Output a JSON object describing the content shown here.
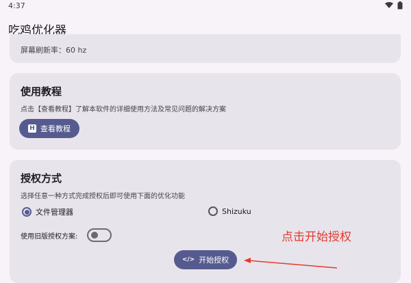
{
  "status_bar": {
    "time": "4:37",
    "icons": [
      "wifi-icon",
      "battery-icon"
    ]
  },
  "app": {
    "title": "吃鸡优化器"
  },
  "display_card": {
    "refresh_text": "屏幕刷新率：60 hz"
  },
  "tutorial_card": {
    "title": "使用教程",
    "description": "点击【查看教程】了解本软件的详细使用方法及常见问题的解决方案",
    "button_label": "查看教程",
    "button_icon_glyph": "H"
  },
  "auth_card": {
    "title": "授权方式",
    "description": "选择任意一种方式完成授权后即可使用下面的优化功能",
    "options": [
      {
        "label": "文件管理器",
        "selected": true
      },
      {
        "label": "Shizuku",
        "selected": false
      }
    ],
    "legacy_label": "使用旧版授权方案:",
    "legacy_enabled": false,
    "start_button_label": "开始授权",
    "start_button_icon_glyph": "</>"
  },
  "annotation": {
    "text": "点击开始授权",
    "color": "#e23b2e"
  },
  "colors": {
    "accent": "#565b8f",
    "card_bg": "#e8e4ec",
    "page_bg": "#f7f3f9"
  }
}
